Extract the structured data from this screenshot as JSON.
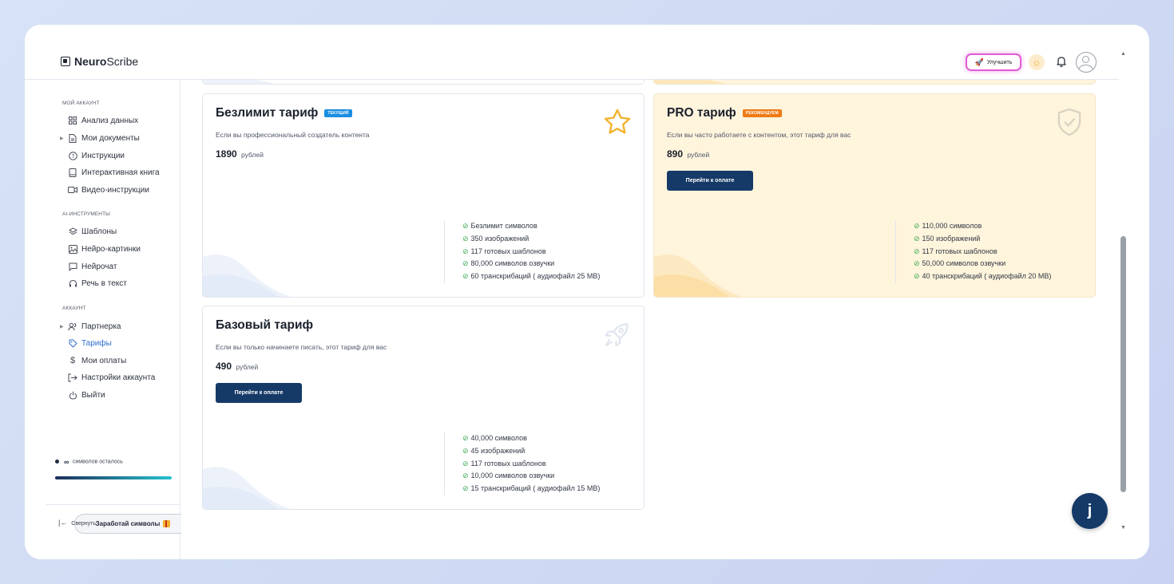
{
  "brand": {
    "name_bold": "Neuro",
    "name_rest": "Scribe"
  },
  "header": {
    "upgrade_label": "Улучшить"
  },
  "sidebar": {
    "sections": [
      {
        "title": "Мой аккаунт",
        "items": [
          {
            "label": "Анализ данных",
            "icon": "grid-icon"
          },
          {
            "label": "Мои документы",
            "icon": "document-icon",
            "expandable": true
          },
          {
            "label": "Инструкции",
            "icon": "help-circle-icon"
          },
          {
            "label": "Интерактивная книга",
            "icon": "book-icon"
          },
          {
            "label": "Видео-инструкции",
            "icon": "video-icon"
          }
        ]
      },
      {
        "title": "AI-инструменты",
        "items": [
          {
            "label": "Шаблоны",
            "icon": "layers-icon"
          },
          {
            "label": "Нейро-картинки",
            "icon": "image-icon"
          },
          {
            "label": "Нейрочат",
            "icon": "chat-icon"
          },
          {
            "label": "Речь в текст",
            "icon": "headphones-icon"
          }
        ]
      },
      {
        "title": "Аккаунт",
        "items": [
          {
            "label": "Партнерка",
            "icon": "users-icon",
            "expandable": true
          },
          {
            "label": "Тарифы",
            "icon": "tag-icon",
            "active": true
          },
          {
            "label": "Мои оплаты",
            "icon": "dollar-icon"
          },
          {
            "label": "Настройки аккаунта",
            "icon": "login-icon"
          },
          {
            "label": "Выйти",
            "icon": "power-icon"
          }
        ]
      }
    ],
    "symbols_infinity": "∞",
    "symbols_label": "символов осталось",
    "symbols_fill_fraction": 1.0,
    "earn_label": "Заработай символы",
    "collapse_label": "Свернуть"
  },
  "plans": [
    {
      "id": "unlimited",
      "title": "Безлимит тариф",
      "badge": "Текущий",
      "description": "Если вы профессиональный создатель контента",
      "price": "1890",
      "currency": "рублей",
      "icon": "star-icon",
      "features": [
        "Безлимит символов",
        "350 изображений",
        "117 готовых шаблонов",
        "80,000 символов озвучки",
        "60 транскрибаций ( аудиофайл 25 MB)"
      ]
    },
    {
      "id": "pro",
      "title": "PRO тариф",
      "badge": "Рекомендуем",
      "description": "Если вы часто работаете с контентом, этот тариф для вас",
      "price": "890",
      "currency": "рублей",
      "pay_label": "Перейти к оплате",
      "icon": "shield-check-icon",
      "features": [
        "110,000 символов",
        "150 изображений",
        "117 готовых шаблонов",
        "50,000 символов озвучки",
        "40 транскрибаций ( аудиофайл 20 MB)"
      ]
    },
    {
      "id": "basic",
      "title": "Базовый тариф",
      "description": "Если вы только начинаете писать, этот тариф для вас",
      "price": "490",
      "currency": "рублей",
      "pay_label": "Перейти к оплате",
      "icon": "rocket-icon",
      "features": [
        "40,000 символов",
        "45 изображений",
        "117 готовых шаблонов",
        "10,000 символов озвучки",
        "15 транскрибаций ( аудиофайл 15 MB)"
      ]
    }
  ],
  "chat_button": {
    "glyph": "j"
  },
  "colors": {
    "primary": "#163a68",
    "active": "#2f6fc9",
    "check": "#3cab53",
    "pro_bg": "#fff4dc"
  }
}
